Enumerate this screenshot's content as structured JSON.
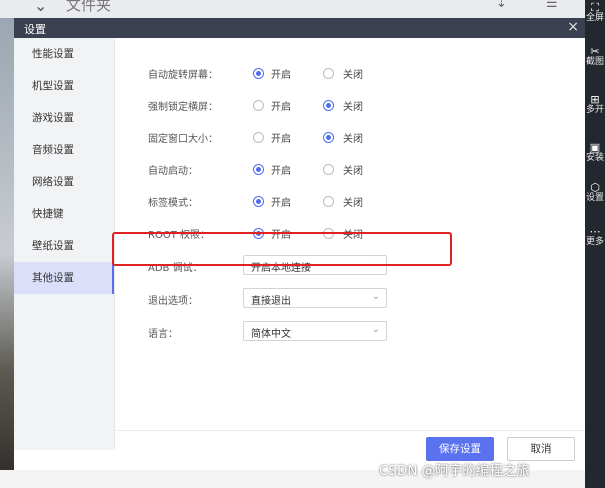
{
  "background": {
    "folder_title": "文件夹",
    "right_toolbar": [
      {
        "icon": "fullscreen-icon",
        "glyph": "⛶",
        "label": "全屏"
      },
      {
        "icon": "scissors-icon",
        "glyph": "✂",
        "label": "截图"
      },
      {
        "icon": "multi-open-icon",
        "glyph": "⊞",
        "label": "多开"
      },
      {
        "icon": "apk-install-icon",
        "glyph": "▣",
        "label": "安装"
      },
      {
        "icon": "settings-hex-icon",
        "glyph": "⬡",
        "label": "设置"
      },
      {
        "icon": "more-icon",
        "glyph": "⋯",
        "label": "更多"
      }
    ]
  },
  "dialog": {
    "title": "设置",
    "close_glyph": "×",
    "sidebar": [
      {
        "label": "性能设置",
        "active": false
      },
      {
        "label": "机型设置",
        "active": false
      },
      {
        "label": "游戏设置",
        "active": false
      },
      {
        "label": "音频设置",
        "active": false
      },
      {
        "label": "网络设置",
        "active": false
      },
      {
        "label": "快捷键",
        "active": false
      },
      {
        "label": "壁纸设置",
        "active": false
      },
      {
        "label": "其他设置",
        "active": true
      }
    ],
    "options": [
      {
        "label": "自动旋转屏幕：",
        "on_label": "开启",
        "off_label": "关闭",
        "selected": "on"
      },
      {
        "label": "强制锁定横屏：",
        "on_label": "开启",
        "off_label": "关闭",
        "selected": "off"
      },
      {
        "label": "固定窗口大小：",
        "on_label": "开启",
        "off_label": "关闭",
        "selected": "off"
      },
      {
        "label": "自动启动：",
        "on_label": "开启",
        "off_label": "关闭",
        "selected": "on"
      },
      {
        "label": "标签模式：",
        "on_label": "开启",
        "off_label": "关闭",
        "selected": "on"
      },
      {
        "label": "ROOT 权限：",
        "on_label": "开启",
        "off_label": "关闭",
        "selected": "on"
      }
    ],
    "selects": [
      {
        "label": "ADB 调试：",
        "value": "开启本地连接"
      },
      {
        "label": "退出选项：",
        "value": "直接退出"
      },
      {
        "label": "语言：",
        "value": "简体中文"
      }
    ],
    "buttons": {
      "save": "保存设置",
      "cancel": "取消"
    }
  },
  "watermark": "CSDN @阿宇的编程之旅",
  "colors": {
    "accent": "#4e6ef2",
    "highlight_border": "#e02121",
    "titlebar": "#3b4150"
  }
}
